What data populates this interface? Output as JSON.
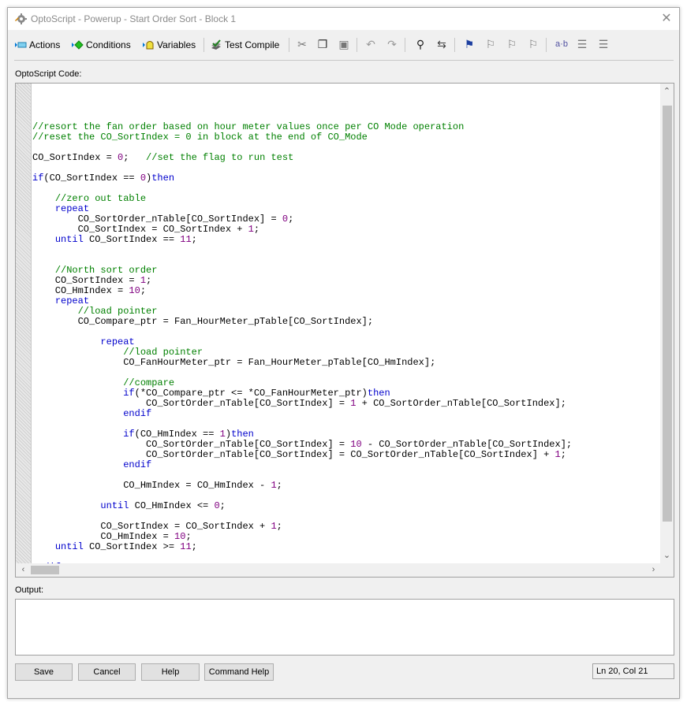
{
  "window": {
    "title": "OptoScript - Powerup - Start Order Sort - Block 1",
    "close_glyph": "✕"
  },
  "toolbar": {
    "actions_label": "Actions",
    "conditions_label": "Conditions",
    "variables_label": "Variables",
    "test_compile_label": "Test Compile",
    "ab_label": "a·b",
    "icons": [
      "cut-icon",
      "copy-icon",
      "paste-icon",
      "undo-icon",
      "redo-icon",
      "find-icon",
      "replace-icon",
      "bookmark-icon",
      "prev-bookmark-icon",
      "next-bookmark-icon",
      "clear-bookmarks-icon",
      "toggle-whitespace-icon",
      "indent-icon",
      "outdent-icon"
    ]
  },
  "labels": {
    "code_label": "OptoScript Code:",
    "output_label": "Output:"
  },
  "code_lines": [
    [],
    [],
    [
      [
        "cm",
        "//resort the fan order based on hour meter values once per CO Mode operation"
      ]
    ],
    [
      [
        "cm",
        "//reset the CO_SortIndex = 0 in block at the end of CO_Mode"
      ]
    ],
    [],
    [
      [
        "tx",
        "CO_SortIndex = "
      ],
      [
        "nm",
        "0"
      ],
      [
        "tx",
        ";   "
      ],
      [
        "cm",
        "//set the flag to run test"
      ]
    ],
    [],
    [
      [
        "kw",
        "if"
      ],
      [
        "tx",
        "(CO_SortIndex == "
      ],
      [
        "nm",
        "0"
      ],
      [
        "tx",
        ")"
      ],
      [
        "kw",
        "then"
      ]
    ],
    [],
    [
      [
        "tx",
        "    "
      ],
      [
        "cm",
        "//zero out table"
      ]
    ],
    [
      [
        "tx",
        "    "
      ],
      [
        "kw",
        "repeat"
      ]
    ],
    [
      [
        "tx",
        "        CO_SortOrder_nTable[CO_SortIndex] = "
      ],
      [
        "nm",
        "0"
      ],
      [
        "tx",
        ";"
      ]
    ],
    [
      [
        "tx",
        "        CO_SortIndex = CO_SortIndex + "
      ],
      [
        "nm",
        "1"
      ],
      [
        "tx",
        ";"
      ]
    ],
    [
      [
        "tx",
        "    "
      ],
      [
        "kw",
        "until"
      ],
      [
        "tx",
        " CO_SortIndex == "
      ],
      [
        "nm",
        "11"
      ],
      [
        "tx",
        ";"
      ]
    ],
    [],
    [],
    [
      [
        "tx",
        "    "
      ],
      [
        "cm",
        "//North sort order"
      ]
    ],
    [
      [
        "tx",
        "    CO_SortIndex = "
      ],
      [
        "nm",
        "1"
      ],
      [
        "tx",
        ";"
      ]
    ],
    [
      [
        "tx",
        "    CO_HmIndex = "
      ],
      [
        "nm",
        "10"
      ],
      [
        "tx",
        ";"
      ]
    ],
    [
      [
        "tx",
        "    "
      ],
      [
        "kw",
        "repeat"
      ]
    ],
    [
      [
        "tx",
        "        "
      ],
      [
        "cm",
        "//load pointer"
      ]
    ],
    [
      [
        "tx",
        "        CO_Compare_ptr = Fan_HourMeter_pTable[CO_SortIndex];"
      ]
    ],
    [],
    [
      [
        "tx",
        "            "
      ],
      [
        "kw",
        "repeat"
      ]
    ],
    [
      [
        "tx",
        "                "
      ],
      [
        "cm",
        "//load pointer"
      ]
    ],
    [
      [
        "tx",
        "                CO_FanHourMeter_ptr = Fan_HourMeter_pTable[CO_HmIndex];"
      ]
    ],
    [],
    [
      [
        "tx",
        "                "
      ],
      [
        "cm",
        "//compare"
      ]
    ],
    [
      [
        "tx",
        "                "
      ],
      [
        "kw",
        "if"
      ],
      [
        "tx",
        "(*CO_Compare_ptr <= *CO_FanHourMeter_ptr)"
      ],
      [
        "kw",
        "then"
      ]
    ],
    [
      [
        "tx",
        "                    CO_SortOrder_nTable[CO_SortIndex] = "
      ],
      [
        "nm",
        "1"
      ],
      [
        "tx",
        " + CO_SortOrder_nTable[CO_SortIndex];"
      ]
    ],
    [
      [
        "tx",
        "                "
      ],
      [
        "kw",
        "endif"
      ]
    ],
    [],
    [
      [
        "tx",
        "                "
      ],
      [
        "kw",
        "if"
      ],
      [
        "tx",
        "(CO_HmIndex == "
      ],
      [
        "nm",
        "1"
      ],
      [
        "tx",
        ")"
      ],
      [
        "kw",
        "then"
      ]
    ],
    [
      [
        "tx",
        "                    CO_SortOrder_nTable[CO_SortIndex] = "
      ],
      [
        "nm",
        "10"
      ],
      [
        "tx",
        " - CO_SortOrder_nTable[CO_SortIndex];"
      ]
    ],
    [
      [
        "tx",
        "                    CO_SortOrder_nTable[CO_SortIndex] = CO_SortOrder_nTable[CO_SortIndex] + "
      ],
      [
        "nm",
        "1"
      ],
      [
        "tx",
        ";"
      ]
    ],
    [
      [
        "tx",
        "                "
      ],
      [
        "kw",
        "endif"
      ]
    ],
    [],
    [
      [
        "tx",
        "                CO_HmIndex = CO_HmIndex - "
      ],
      [
        "nm",
        "1"
      ],
      [
        "tx",
        ";"
      ]
    ],
    [],
    [
      [
        "tx",
        "            "
      ],
      [
        "kw",
        "until"
      ],
      [
        "tx",
        " CO_HmIndex <= "
      ],
      [
        "nm",
        "0"
      ],
      [
        "tx",
        ";"
      ]
    ],
    [],
    [
      [
        "tx",
        "            CO_SortIndex = CO_SortIndex + "
      ],
      [
        "nm",
        "1"
      ],
      [
        "tx",
        ";"
      ]
    ],
    [
      [
        "tx",
        "            CO_HmIndex = "
      ],
      [
        "nm",
        "10"
      ],
      [
        "tx",
        ";"
      ]
    ],
    [
      [
        "tx",
        "    "
      ],
      [
        "kw",
        "until"
      ],
      [
        "tx",
        " CO_SortIndex >= "
      ],
      [
        "nm",
        "11"
      ],
      [
        "tx",
        ";"
      ]
    ],
    [],
    [
      [
        "kw",
        "endif"
      ]
    ]
  ],
  "buttons": {
    "save": "Save",
    "cancel": "Cancel",
    "help": "Help",
    "command_help": "Command Help"
  },
  "status": {
    "position": "Ln 20, Col 21"
  },
  "colors": {
    "keyword": "#0000cc",
    "comment": "#008000",
    "number": "#800080"
  }
}
